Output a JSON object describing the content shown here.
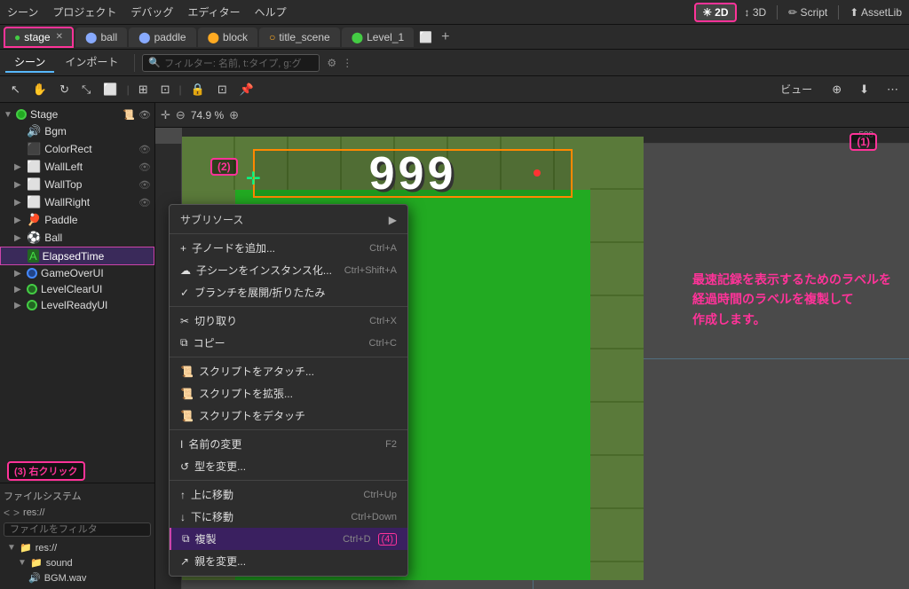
{
  "menubar": {
    "items": [
      "シーン",
      "プロジェクト",
      "デバッグ",
      "エディター",
      "ヘルプ"
    ],
    "btn_2d": "✳ 2D",
    "btn_3d": "↕ 3D",
    "btn_script": "✏ Script",
    "btn_assetlib": "⬆ AssetLib"
  },
  "tabs": [
    {
      "label": "stage",
      "active": true,
      "closable": true
    },
    {
      "label": "ball",
      "active": false,
      "closable": false
    },
    {
      "label": "paddle",
      "active": false,
      "closable": false
    },
    {
      "label": "block",
      "active": false,
      "closable": false
    },
    {
      "label": "title_scene",
      "active": false,
      "closable": false
    },
    {
      "label": "Level_1",
      "active": false,
      "closable": false
    }
  ],
  "scene_tabs": [
    "シーン",
    "インポート"
  ],
  "filter_placeholder": "フィルター: 名前, t:タイプ, g:グ",
  "tree": {
    "root": {
      "label": "Stage",
      "icon": "circle-green",
      "children": [
        {
          "label": "Bgm",
          "icon": "audio",
          "indent": 1
        },
        {
          "label": "ColorRect",
          "icon": "colorrect",
          "indent": 1,
          "eye": true
        },
        {
          "label": "WallLeft",
          "icon": "box",
          "indent": 1,
          "eye": true
        },
        {
          "label": "WallTop",
          "icon": "box",
          "indent": 1,
          "eye": true
        },
        {
          "label": "WallRight",
          "icon": "box",
          "indent": 1,
          "eye": true
        },
        {
          "label": "Paddle",
          "icon": "paddle",
          "indent": 1
        },
        {
          "label": "Ball",
          "icon": "ball",
          "indent": 1
        },
        {
          "label": "ElapsedTime",
          "icon": "label-green",
          "indent": 1,
          "selected": true
        },
        {
          "label": "GameOverUI",
          "icon": "circle-blue",
          "indent": 1,
          "arrow": true
        },
        {
          "label": "LevelClearUI",
          "icon": "circle-blue",
          "indent": 1,
          "arrow": true
        },
        {
          "label": "LevelReadyUI",
          "icon": "circle-blue",
          "indent": 1,
          "arrow": true
        }
      ]
    }
  },
  "filesystem": {
    "title": "ファイルシステム",
    "nav": [
      "<",
      ">"
    ],
    "path": "res://",
    "filter_placeholder": "ファイルをフィルタ",
    "dirs": [
      {
        "label": "res://",
        "indent": 0
      },
      {
        "label": "sound",
        "indent": 1
      },
      {
        "label": "BGM.wav",
        "indent": 2
      }
    ]
  },
  "context_menu": {
    "header": "サブリソース",
    "items": [
      {
        "label": "+ 子ノードを追加...",
        "shortcut": "Ctrl+A",
        "type": "item"
      },
      {
        "label": "☁ 子シーンをインスタンス化...",
        "shortcut": "Ctrl+Shift+A",
        "type": "item"
      },
      {
        "label": "✓ ブランチを展開/折りたたみ",
        "shortcut": "",
        "type": "item"
      },
      {
        "type": "sep"
      },
      {
        "label": "✂ 切り取り",
        "shortcut": "Ctrl+X",
        "type": "item"
      },
      {
        "label": "⧉ コピー",
        "shortcut": "Ctrl+C",
        "type": "item"
      },
      {
        "type": "sep"
      },
      {
        "label": "⚙ スクリプトをアタッチ...",
        "shortcut": "",
        "type": "item"
      },
      {
        "label": "⚙ スクリプトを拡張...",
        "shortcut": "",
        "type": "item"
      },
      {
        "label": "⚙ スクリプトをデタッチ",
        "shortcut": "",
        "type": "item"
      },
      {
        "type": "sep"
      },
      {
        "label": "I 名前の変更",
        "shortcut": "F2",
        "type": "item"
      },
      {
        "label": "↺ 型を変更...",
        "shortcut": "",
        "type": "item"
      },
      {
        "type": "sep"
      },
      {
        "label": "↑ 上に移動",
        "shortcut": "Ctrl+Up",
        "type": "item"
      },
      {
        "label": "↓ 下に移動",
        "shortcut": "Ctrl+Down",
        "type": "item"
      },
      {
        "label": "⧉ 複製",
        "shortcut": "Ctrl+D",
        "type": "item",
        "highlighted": true
      },
      {
        "label": "↗ 親を変更...",
        "shortcut": "",
        "type": "item"
      }
    ]
  },
  "viewport": {
    "zoom": "74.9 %",
    "annotation_text": "最速記録を表示するためのラベルを\n経過時間のラベルを複製して\n作成します。",
    "score": "999"
  },
  "callouts": {
    "c1": "(1)",
    "c2": "(2)",
    "c3": "(3) 右クリック",
    "c4": "(4)"
  },
  "tools": {
    "icons": [
      "↖",
      "↻",
      "⟲",
      "⬜",
      "✋",
      "↗",
      "|",
      "⊞",
      "⊞",
      "⊞",
      "in",
      "⊡",
      "|",
      "✂",
      "⊡",
      "🔒",
      "⊡"
    ]
  }
}
